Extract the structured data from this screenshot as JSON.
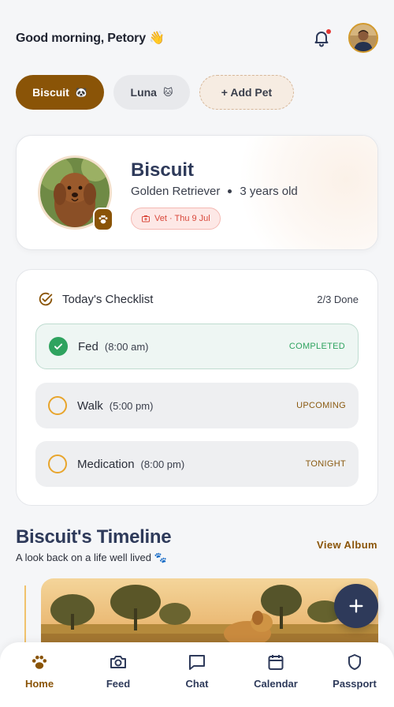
{
  "header": {
    "greeting": "Good morning, Petory",
    "greeting_emoji": "👋",
    "has_notification": true
  },
  "pets": [
    {
      "label": "Biscuit",
      "emoji": "🐼",
      "active": true
    },
    {
      "label": "Luna",
      "emoji": "🐱",
      "active": false
    }
  ],
  "add_pet_label": "+ Add Pet",
  "profile": {
    "name": "Biscuit",
    "breed": "Golden Retriever",
    "age": "3 years old",
    "vet": "Vet · Thu 9 Jul"
  },
  "checklist": {
    "title": "Today's Checklist",
    "count": "2/3 Done",
    "tasks": [
      {
        "name": "Fed",
        "time": "(8:00 am)",
        "status": "COMPLETED",
        "done": true
      },
      {
        "name": "Walk",
        "time": "(5:00 pm)",
        "status": "UPCOMING",
        "done": false
      },
      {
        "name": "Medication",
        "time": "(8:00 pm)",
        "status": "TONIGHT",
        "done": false
      }
    ]
  },
  "timeline": {
    "title": "Biscuit's Timeline",
    "subtitle": "A look back on a life well lived 🐾",
    "view_album": "View Album"
  },
  "nav": [
    {
      "label": "Home",
      "icon": "paw-icon",
      "active": true
    },
    {
      "label": "Feed",
      "icon": "camera-icon",
      "active": false
    },
    {
      "label": "Chat",
      "icon": "chat-bubble-icon",
      "active": false
    },
    {
      "label": "Calendar",
      "icon": "calendar-icon",
      "active": false
    },
    {
      "label": "Passport",
      "icon": "shield-icon",
      "active": false
    }
  ],
  "colors": {
    "brand": "#8a5407",
    "navy": "#2e3a5a",
    "success": "#2fa35f",
    "pending_ring": "#e8a52c",
    "vet_red": "#d9483b"
  }
}
